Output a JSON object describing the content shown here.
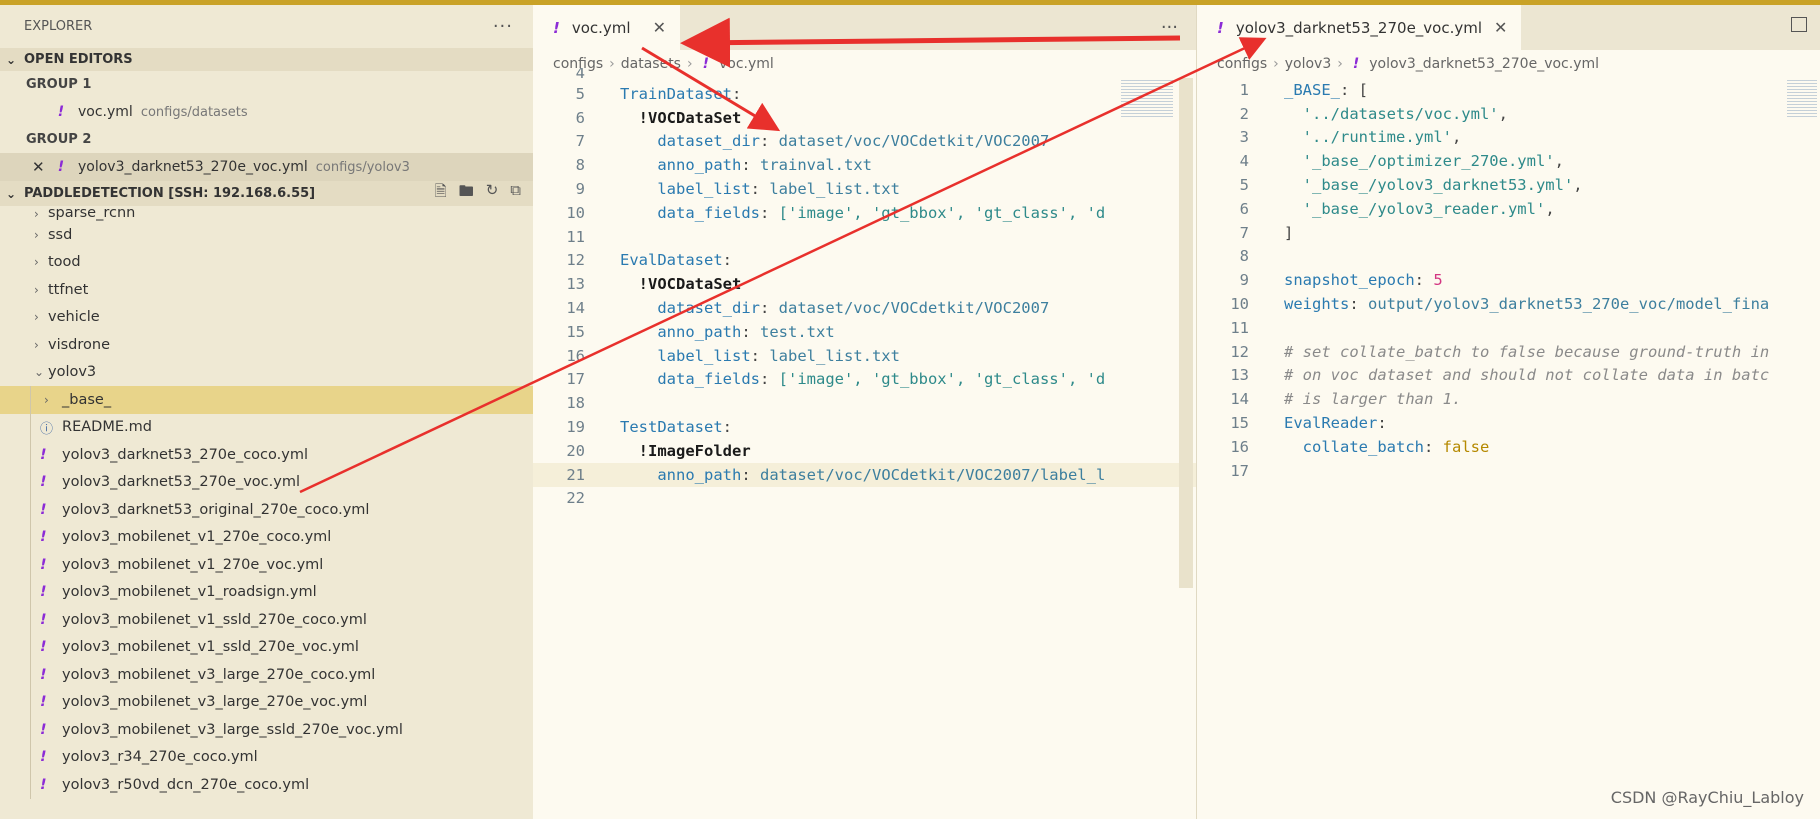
{
  "sidebar": {
    "title": "EXPLORER",
    "more": "···",
    "open_editors": {
      "label": "OPEN EDITORS",
      "group1": "GROUP 1",
      "group1_file": {
        "name": "voc.yml",
        "desc": "configs/datasets"
      },
      "group2": "GROUP 2",
      "group2_file": {
        "name": "yolov3_darknet53_270e_voc.yml",
        "desc": "configs/yolov3"
      }
    },
    "project": {
      "label": "PADDLEDETECTION [SSH: 192.168.6.55]"
    },
    "tree": {
      "partial_top": "sparse_rcnn",
      "folders": [
        "ssd",
        "tood",
        "ttfnet",
        "vehicle",
        "visdrone"
      ],
      "open_folder": "yolov3",
      "base_folder": "_base_",
      "readme": "README.md",
      "files": [
        "yolov3_darknet53_270e_coco.yml",
        "yolov3_darknet53_270e_voc.yml",
        "yolov3_darknet53_original_270e_coco.yml",
        "yolov3_mobilenet_v1_270e_coco.yml",
        "yolov3_mobilenet_v1_270e_voc.yml",
        "yolov3_mobilenet_v1_roadsign.yml",
        "yolov3_mobilenet_v1_ssld_270e_coco.yml",
        "yolov3_mobilenet_v1_ssld_270e_voc.yml",
        "yolov3_mobilenet_v3_large_270e_coco.yml",
        "yolov3_mobilenet_v3_large_270e_voc.yml",
        "yolov3_mobilenet_v3_large_ssld_270e_voc.yml",
        "yolov3_r34_270e_coco.yml",
        "yolov3_r50vd_dcn_270e_coco.yml"
      ]
    }
  },
  "editor1": {
    "tab": "voc.yml",
    "breadcrumb": [
      "configs",
      "datasets",
      "voc.yml"
    ],
    "first_line_no": "4",
    "lines": {
      "l5_key": "TrainDataset",
      "l6_tag": "!VOCDataSet",
      "l7_key": "dataset_dir",
      "l7_val": "dataset/voc/VOCdetkit/VOC2007",
      "l8_key": "anno_path",
      "l8_val": "trainval.txt",
      "l9_key": "label_list",
      "l9_val": "label_list.txt",
      "l10_key": "data_fields",
      "l10_val": "['image', 'gt_bbox', 'gt_class', 'd",
      "l12_key": "EvalDataset",
      "l13_tag": "!VOCDataSet",
      "l14_key": "dataset_dir",
      "l14_val": "dataset/voc/VOCdetkit/VOC2007",
      "l15_key": "anno_path",
      "l15_val": "test.txt",
      "l16_key": "label_list",
      "l16_val": "label_list.txt",
      "l17_key": "data_fields",
      "l17_val": "['image', 'gt_bbox', 'gt_class', 'd",
      "l19_key": "TestDataset",
      "l20_tag": "!ImageFolder",
      "l21_key": "anno_path",
      "l21_val": "dataset/voc/VOCdetkit/VOC2007/label_l"
    }
  },
  "editor2": {
    "tab": "yolov3_darknet53_270e_voc.yml",
    "breadcrumb": [
      "configs",
      "yolov3",
      "yolov3_darknet53_270e_voc.yml"
    ],
    "lines": {
      "l1_key": "_BASE_",
      "l2": "'../datasets/voc.yml'",
      "l3": "'../runtime.yml'",
      "l4": "'_base_/optimizer_270e.yml'",
      "l5": "'_base_/yolov3_darknet53.yml'",
      "l6": "'_base_/yolov3_reader.yml'",
      "l9_key": "snapshot_epoch",
      "l9_val": "5",
      "l10_key": "weights",
      "l10_val": "output/yolov3_darknet53_270e_voc/model_fina",
      "l12": "# set collate_batch to false because ground-truth in",
      "l13": "# on voc dataset and should not collate data in batc",
      "l14": "# is larger than 1.",
      "l15_key": "EvalReader",
      "l16_key": "collate_batch",
      "l16_val": "false"
    }
  },
  "watermark": "CSDN @RayChiu_Labloy",
  "colors": {
    "accent": "#c9a227",
    "arrow": "#e8302c",
    "yaml_tag": "#8c2bd6"
  }
}
